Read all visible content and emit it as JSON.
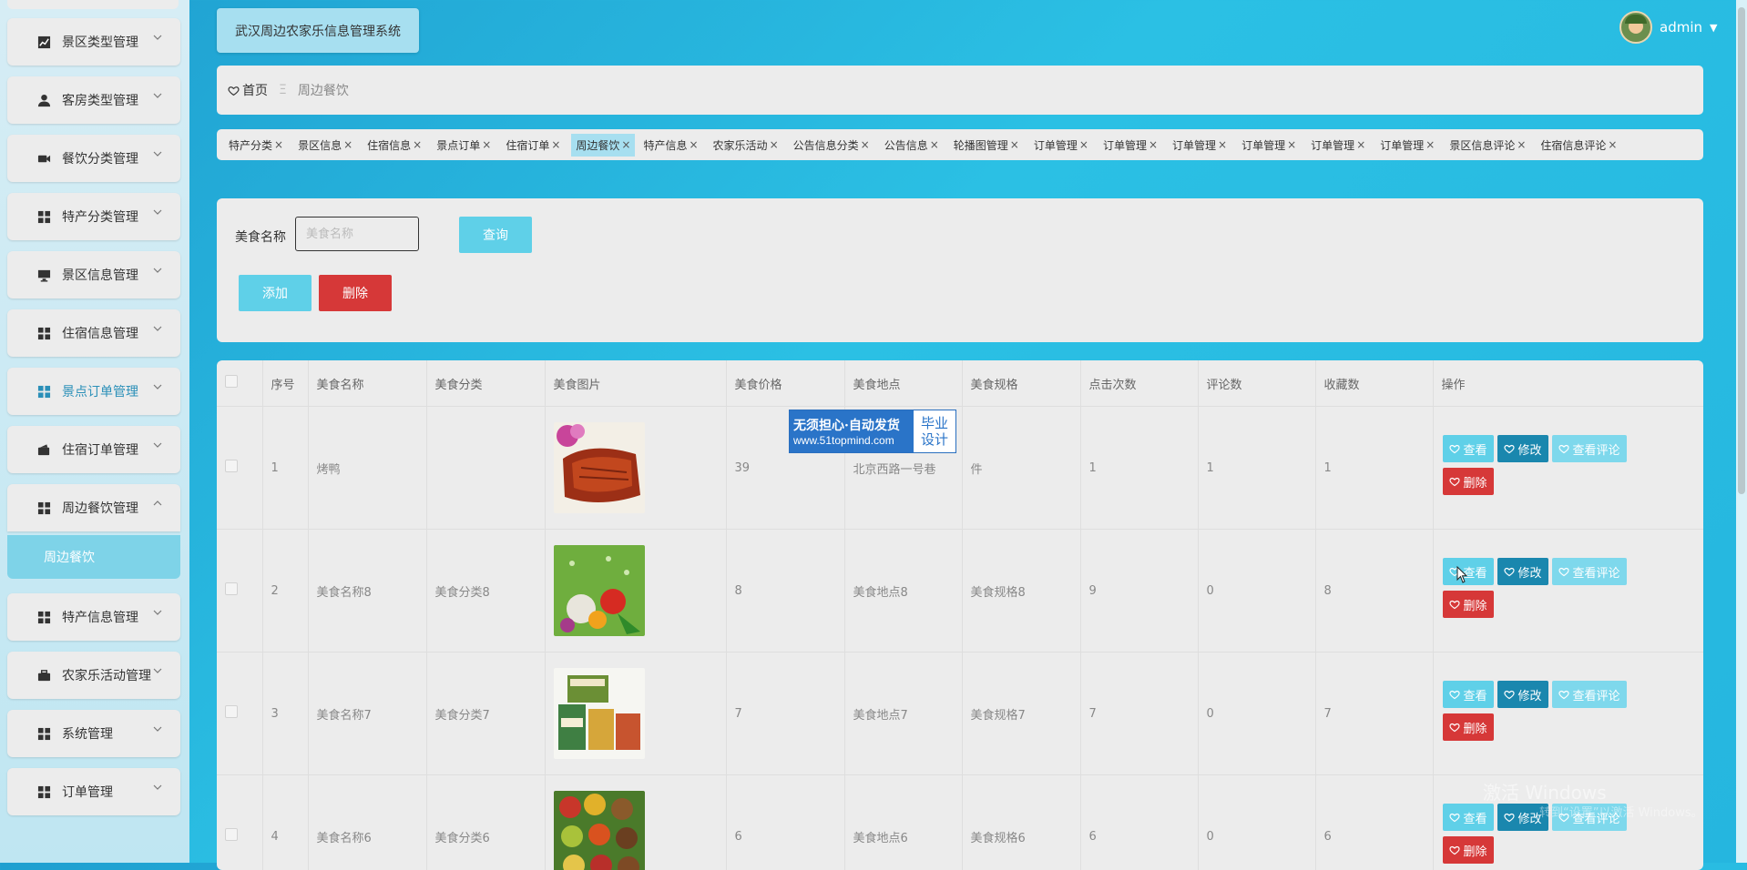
{
  "app_title": "武汉周边农家乐信息管理系统",
  "user": {
    "name": "admin"
  },
  "sidebar": {
    "items": [
      {
        "label": "景区类型管理",
        "icon": "chart-icon"
      },
      {
        "label": "客房类型管理",
        "icon": "person-icon"
      },
      {
        "label": "餐饮分类管理",
        "icon": "camera-icon"
      },
      {
        "label": "特产分类管理",
        "icon": "grid-icon"
      },
      {
        "label": "景区信息管理",
        "icon": "monitor-icon"
      },
      {
        "label": "住宿信息管理",
        "icon": "grid-icon"
      },
      {
        "label": "景点订单管理",
        "icon": "grid-icon"
      },
      {
        "label": "住宿订单管理",
        "icon": "wallet-icon"
      },
      {
        "label": "周边餐饮管理",
        "icon": "grid-icon"
      },
      {
        "label": "特产信息管理",
        "icon": "grid-icon"
      },
      {
        "label": "农家乐活动管理",
        "icon": "briefcase-icon"
      },
      {
        "label": "系统管理",
        "icon": "grid-icon"
      },
      {
        "label": "订单管理",
        "icon": "grid-icon"
      }
    ],
    "sub_item": "周边餐饮"
  },
  "breadcrumb": {
    "home": "首页",
    "separator": "Ξ",
    "current": "周边餐饮"
  },
  "tags": [
    "特产分类",
    "景区信息",
    "住宿信息",
    "景点订单",
    "住宿订单",
    "周边餐饮",
    "特产信息",
    "农家乐活动",
    "公告信息分类",
    "公告信息",
    "轮播图管理",
    "订单管理",
    "订单管理",
    "订单管理",
    "订单管理",
    "订单管理",
    "订单管理",
    "景区信息评论",
    "住宿信息评论"
  ],
  "active_tag": "周边餐饮",
  "search": {
    "label": "美食名称",
    "placeholder": "美食名称",
    "query_button": "查询",
    "add_button": "添加",
    "delete_button": "删除"
  },
  "table": {
    "headers": [
      "序号",
      "美食名称",
      "美食分类",
      "美食图片",
      "美食价格",
      "美食地点",
      "美食规格",
      "点击次数",
      "评论数",
      "收藏数",
      "操作"
    ],
    "rows": [
      {
        "no": "1",
        "name": "烤鸭",
        "category": "",
        "price": "39",
        "place": "北京西路一号巷",
        "spec": "件",
        "clicks": "1",
        "comments": "1",
        "favorites": "1",
        "image": "roast-duck"
      },
      {
        "no": "2",
        "name": "美食名称8",
        "category": "美食分类8",
        "price": "8",
        "place": "美食地点8",
        "spec": "美食规格8",
        "clicks": "9",
        "comments": "0",
        "favorites": "8",
        "image": "vegetables"
      },
      {
        "no": "3",
        "name": "美食名称7",
        "category": "美食分类7",
        "price": "7",
        "place": "美食地点7",
        "spec": "美食规格7",
        "clicks": "7",
        "comments": "0",
        "favorites": "7",
        "image": "snack-boxes"
      },
      {
        "no": "4",
        "name": "美食名称6",
        "category": "美食分类6",
        "price": "6",
        "place": "美食地点6",
        "spec": "美食规格6",
        "clicks": "6",
        "comments": "0",
        "favorites": "6",
        "image": "fruits"
      }
    ],
    "ops": {
      "view": "查看",
      "edit": "修改",
      "reviews": "查看评论",
      "delete": "删除"
    }
  },
  "watermark": {
    "line1": "激活 Windows",
    "line2": "转到“设置”以激活 Windows。"
  },
  "ad": {
    "line1": "无须担心·自动发货",
    "line2": "www.51topmind.com",
    "right1": "毕业",
    "right2": "设计"
  },
  "colors": {
    "accent": "#5fd0e8",
    "edit": "#1a87ae",
    "danger": "#d63838",
    "panel": "#ececec"
  }
}
